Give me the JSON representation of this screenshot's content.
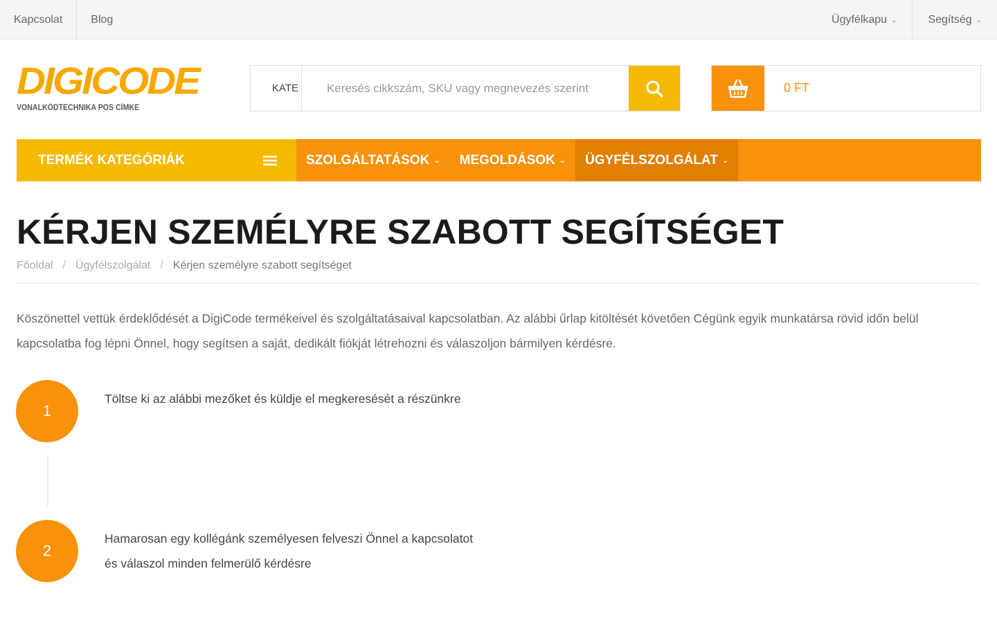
{
  "topbar": {
    "left_links": [
      "Kapcsolat",
      "Blog"
    ],
    "right_links": [
      "Ügyfélkapu",
      "Segítség"
    ]
  },
  "logo": {
    "main": "DIGICODE",
    "sub": "VONALKÓDTECHNIKA POS CÍMKE"
  },
  "search": {
    "category_label": "KATE",
    "placeholder": "Keresés cikkszám, SKU vagy megnevezés szerint",
    "button_icon": "search-icon"
  },
  "cart": {
    "icon": "basket-icon",
    "total": "0 FT"
  },
  "nav": {
    "categories_label": "TERMÉK KATEGÓRIÁK",
    "items": [
      {
        "label": "SZOLGÁLTATÁSOK",
        "active": false
      },
      {
        "label": "MEGOLDÁSOK",
        "active": false
      },
      {
        "label": "ÜGYFÉLSZOLGÁLAT",
        "active": true
      }
    ]
  },
  "page": {
    "title": "KÉRJEN SZEMÉLYRE SZABOTT SEGÍTSÉGET",
    "breadcrumb": [
      "Főoldal",
      "Ügyfélszolgálat",
      "Kérjen személyre szabott segítséget"
    ],
    "intro": "Köszönettel vettük érdeklődését a DigiCode termékeivel és szolgáltatásaival kapcsolatban. Az alábbi űrlap kitöltését követően Cégünk egyik munkatársa rövid időn belül kapcsolatba fog lépni Önnel, hogy segítsen a saját, dedikált fiókját létrehozni és válaszoljon bármilyen kérdésre."
  },
  "steps": [
    {
      "number": "1",
      "text": "Töltse ki az alábbi mezőket és küldje el megkeresését a részünkre"
    },
    {
      "number": "2",
      "text": "Hamarosan egy kollégánk személyesen felveszi Önnel a kapcsolatot és válaszol minden felmerülő kérdésre"
    }
  ],
  "colors": {
    "orange": "#f7920a",
    "yellow": "#f7b900",
    "active_nav": "#e07f00"
  }
}
